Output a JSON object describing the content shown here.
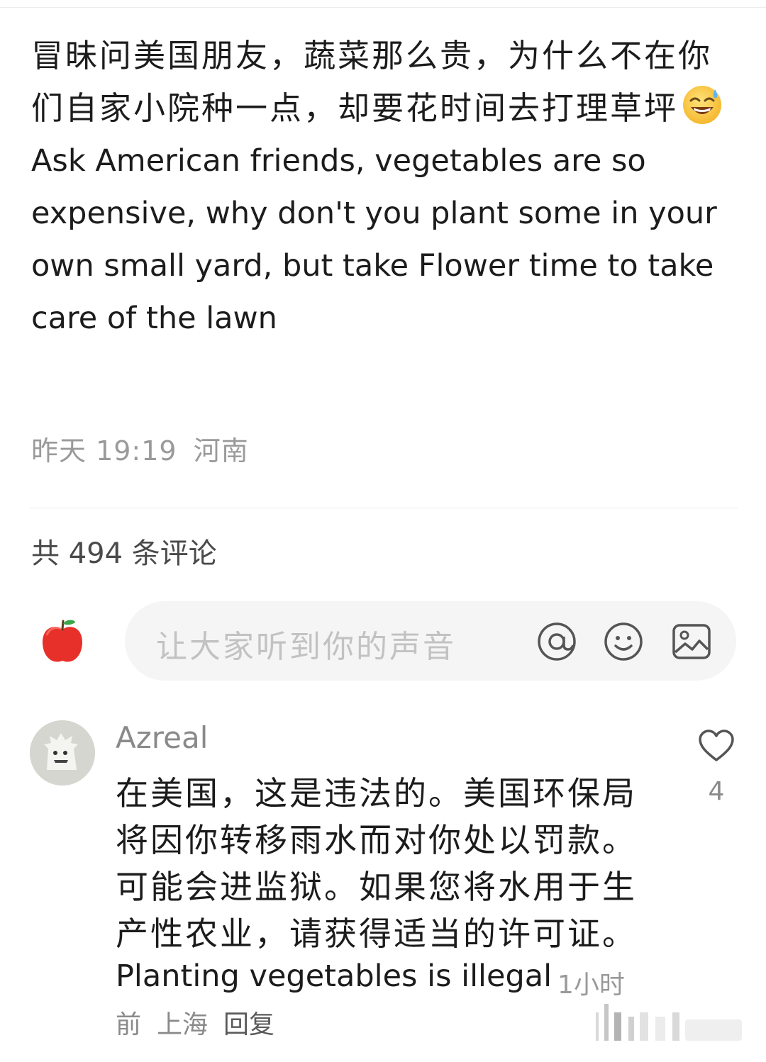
{
  "post": {
    "text_zh": "冒昧问美国朋友，蔬菜那么贵，为什么不在你们自家小院种一点，却要花时间去打理草坪",
    "text_en": "Ask American friends, vegetables are so expensive, why don't you plant some in your own small yard, but take Flower time to take care of the lawn",
    "emoji": "sweat-smile-emoji",
    "time": "昨天 19:19",
    "location": "河南"
  },
  "comments_header": {
    "count_label": "共 494 条评论"
  },
  "composer": {
    "placeholder": "让大家听到你的声音",
    "icons": [
      "at-icon",
      "emoji-icon",
      "image-icon"
    ],
    "avatar": "apple-icon"
  },
  "comment": {
    "author": "Azreal",
    "text": "在美国，这是违法的。美国环保局将因你转移雨水而对你处以罚款。可能会进监狱。如果您将水用于生产性农业，请获得适当的许可证。",
    "text_en": "Planting vegetables is illegal",
    "time_part1": "1小时",
    "time_part2": "前",
    "location": "上海",
    "reply_label": "回复",
    "likes": "4"
  },
  "colors": {
    "text": "#1c1c1c",
    "muted": "#9a9a9a",
    "composer_bg": "#f5f5f5",
    "placeholder": "#c2c2c2"
  }
}
